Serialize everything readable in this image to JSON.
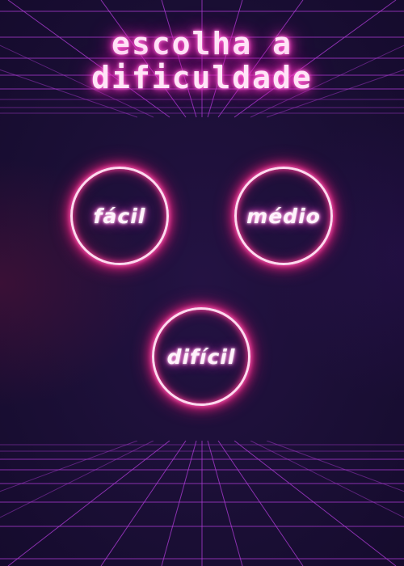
{
  "title": {
    "line1": "escolha a",
    "line2": "dificuldade"
  },
  "difficulties": [
    {
      "label": "fácil"
    },
    {
      "label": "médio"
    },
    {
      "label": "difícil"
    }
  ],
  "colors": {
    "background": "#1b0f36",
    "grid": "#b03cd8",
    "title_glow": "#ff3fc8",
    "button_ring": "#ff2f93",
    "text": "#fff2fb"
  }
}
